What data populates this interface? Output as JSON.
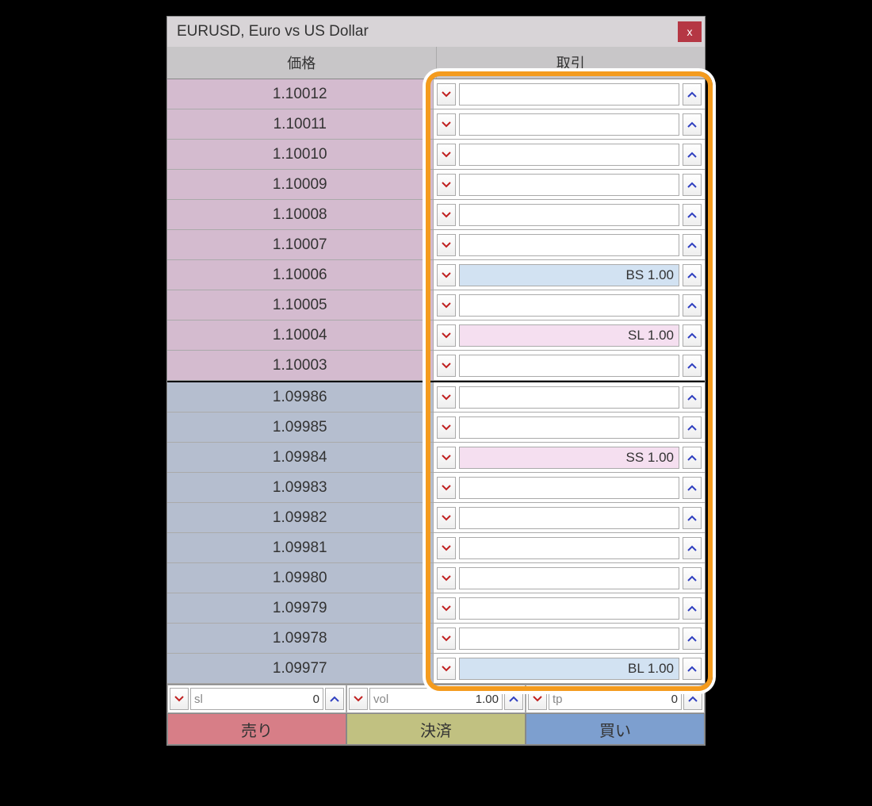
{
  "title": "EURUSD, Euro vs US Dollar",
  "close_icon": "x",
  "columns": {
    "price": "価格",
    "trade": "取引"
  },
  "asks": [
    {
      "price": "1.10012",
      "order": ""
    },
    {
      "price": "1.10011",
      "order": ""
    },
    {
      "price": "1.10010",
      "order": ""
    },
    {
      "price": "1.10009",
      "order": ""
    },
    {
      "price": "1.10008",
      "order": ""
    },
    {
      "price": "1.10007",
      "order": ""
    },
    {
      "price": "1.10006",
      "order": "BS 1.00",
      "tone": "blue"
    },
    {
      "price": "1.10005",
      "order": ""
    },
    {
      "price": "1.10004",
      "order": "SL 1.00",
      "tone": "pink"
    },
    {
      "price": "1.10003",
      "order": ""
    }
  ],
  "bids": [
    {
      "price": "1.09986",
      "order": ""
    },
    {
      "price": "1.09985",
      "order": ""
    },
    {
      "price": "1.09984",
      "order": "SS 1.00",
      "tone": "pink"
    },
    {
      "price": "1.09983",
      "order": ""
    },
    {
      "price": "1.09982",
      "order": ""
    },
    {
      "price": "1.09981",
      "order": ""
    },
    {
      "price": "1.09980",
      "order": ""
    },
    {
      "price": "1.09979",
      "order": ""
    },
    {
      "price": "1.09978",
      "order": ""
    },
    {
      "price": "1.09977",
      "order": "BL 1.00",
      "tone": "blue"
    }
  ],
  "inputs": {
    "sl": {
      "label": "sl",
      "value": "0"
    },
    "vol": {
      "label": "vol",
      "value": "1.00"
    },
    "tp": {
      "label": "tp",
      "value": "0"
    }
  },
  "buttons": {
    "sell": "売り",
    "close": "決済",
    "buy": "買い"
  }
}
